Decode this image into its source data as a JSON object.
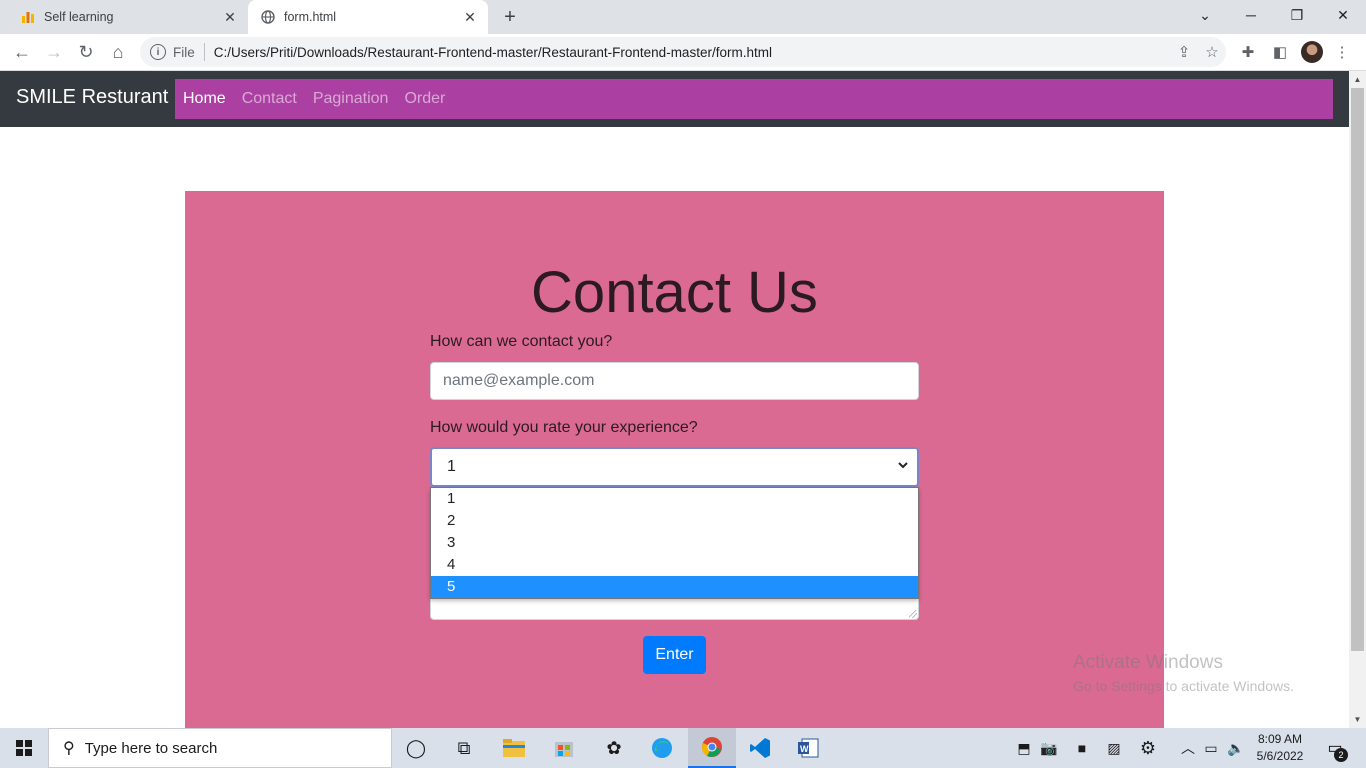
{
  "browser": {
    "tabs": [
      {
        "title": "Self learning",
        "icon": "chart-favicon-icon",
        "active": false
      },
      {
        "title": "form.html",
        "icon": "globe-icon",
        "active": true
      }
    ],
    "omnibox": {
      "scheme_label": "File",
      "url": "C:/Users/Priti/Downloads/Restaurant-Frontend-master/Restaurant-Frontend-master/form.html"
    }
  },
  "site": {
    "brand": "SMILE Resturant",
    "nav": [
      {
        "label": "Home",
        "active": true
      },
      {
        "label": "Contact",
        "active": false
      },
      {
        "label": "Pagination",
        "active": false
      },
      {
        "label": "Order",
        "active": false
      }
    ],
    "nav_bg_color": "#ab3fa2",
    "panel_color": "#db6a93"
  },
  "form": {
    "heading": "Contact Us",
    "contact_label": "How can we contact you?",
    "email_placeholder": "name@example.com",
    "rating_label": "How would you rate your experience?",
    "rating_selected": "1",
    "rating_options": [
      "1",
      "2",
      "3",
      "4",
      "5"
    ],
    "rating_highlighted": "5",
    "submit_label": "Enter"
  },
  "watermark": {
    "line1": "Activate Windows",
    "line2": "Go to Settings to activate Windows."
  },
  "taskbar": {
    "search_placeholder": "Type here to search",
    "time": "8:09 AM",
    "date": "5/6/2022",
    "notification_count": "2"
  }
}
